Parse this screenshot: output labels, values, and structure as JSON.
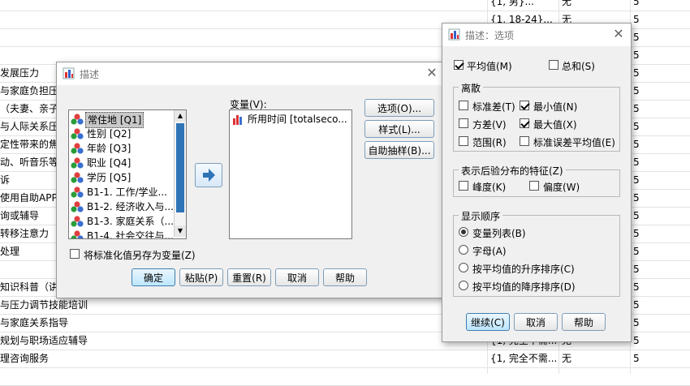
{
  "background": {
    "rows": [
      {
        "label": "",
        "c1": "{1, 男}...",
        "c2": "无",
        "c3": "5"
      },
      {
        "label": "",
        "c1": "{1, 18-24}...",
        "c2": "无",
        "c3": "5"
      },
      {
        "label": "",
        "c1": "",
        "c2": "",
        "c3": "5"
      },
      {
        "label": "",
        "c1": "",
        "c2": "",
        "c3": "5"
      },
      {
        "label": "发展压力",
        "c1": "",
        "c2": "",
        "c3": "5"
      },
      {
        "label": "与家庭负担压",
        "c1": "",
        "c2": "",
        "c3": "5"
      },
      {
        "label": "（夫妻、亲子",
        "c1": "",
        "c2": "",
        "c3": "5"
      },
      {
        "label": "与人际关系压",
        "c1": "",
        "c2": "",
        "c3": "5"
      },
      {
        "label": "定性带来的焦",
        "c1": "",
        "c2": "",
        "c3": "5"
      },
      {
        "label": "动、听音乐等",
        "c1": "",
        "c2": "",
        "c3": "5"
      },
      {
        "label": "诉",
        "c1": "",
        "c2": "",
        "c3": "5"
      },
      {
        "label": "使用自助APP",
        "c1": "",
        "c2": "",
        "c3": "5"
      },
      {
        "label": "询或辅导",
        "c1": "",
        "c2": "",
        "c3": "5"
      },
      {
        "label": "转移注意力",
        "c1": "",
        "c2": "",
        "c3": "5"
      },
      {
        "label": "处理",
        "c1": "",
        "c2": "",
        "c3": "5"
      },
      {
        "label": "",
        "c1": "",
        "c2": "",
        "c3": "5"
      },
      {
        "label": "知识科普（讲",
        "c1": "",
        "c2": "",
        "c3": "5"
      },
      {
        "label": "与压力调节技能培训",
        "c1": "",
        "c2": "",
        "c3": "5"
      },
      {
        "label": "与家庭关系指导",
        "c1": "",
        "c2": "",
        "c3": "5"
      },
      {
        "label": "规划与职场适应辅导",
        "c1": "{1, 完全不需...",
        "c2": "无",
        "c3": "5"
      },
      {
        "label": "理咨询服务",
        "c1": "{1, 完全不需...",
        "c2": "无",
        "c3": "5"
      },
      {
        "label": "",
        "c1": "",
        "c2": "",
        "c3": ""
      }
    ]
  },
  "describe_dialog": {
    "title": "描述",
    "variables_list": [
      {
        "label": "常住地 [Q1]",
        "selected": true
      },
      {
        "label": "性别 [Q2]",
        "selected": false
      },
      {
        "label": "年龄 [Q3]",
        "selected": false
      },
      {
        "label": "职业 [Q4]",
        "selected": false
      },
      {
        "label": "学历 [Q5]",
        "selected": false
      },
      {
        "label": "B1-1. 工作/学业...",
        "selected": false
      },
      {
        "label": "B1-2. 经济收入与...",
        "selected": false
      },
      {
        "label": "B1-3. 家庭关系（...",
        "selected": false
      },
      {
        "label": "B1-4. 社会交往与...",
        "selected": false
      }
    ],
    "target_label": "变量(V):",
    "target_items": [
      {
        "label": "所用时间 [totalseco..."
      }
    ],
    "side_buttons": {
      "options": "选项(O)...",
      "style": "样式(L)...",
      "bootstrap": "自助抽样(B)..."
    },
    "save_std_label": "将标准化值另存为变量(Z)",
    "save_std_checked": false,
    "bottom_buttons": {
      "ok": "确定",
      "paste": "粘贴(P)",
      "reset": "重置(R)",
      "cancel": "取消",
      "help": "帮助"
    }
  },
  "options_dialog": {
    "title": "描述：选项",
    "mean_label": "平均值(M)",
    "mean_checked": true,
    "sum_label": "总和(S)",
    "sum_checked": false,
    "dispersion": {
      "title": "离散",
      "std": {
        "label": "标准差(T)",
        "checked": false
      },
      "min": {
        "label": "最小值(N)",
        "checked": true
      },
      "variance": {
        "label": "方差(V)",
        "checked": false
      },
      "max": {
        "label": "最大值(X)",
        "checked": true
      },
      "range": {
        "label": "范围(R)",
        "checked": false
      },
      "se_mean": {
        "label": "标准误差平均值(E)",
        "checked": false
      }
    },
    "distribution": {
      "title": "表示后验分布的特征(Z)",
      "kurtosis": {
        "label": "峰度(K)",
        "checked": false
      },
      "skewness": {
        "label": "偏度(W)",
        "checked": false
      }
    },
    "display_order": {
      "title": "显示顺序",
      "options": [
        {
          "label": "变量列表(B)",
          "selected": true
        },
        {
          "label": "字母(A)",
          "selected": false
        },
        {
          "label": "按平均值的升序排序(C)",
          "selected": false
        },
        {
          "label": "按平均值的降序排序(D)",
          "selected": false
        }
      ]
    },
    "buttons": {
      "continue": "继续(C)",
      "cancel": "取消",
      "help": "帮助"
    }
  }
}
